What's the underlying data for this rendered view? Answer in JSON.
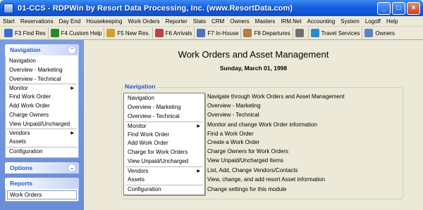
{
  "window": {
    "title": "01-CCS - RDPWin by Resort Data Processing, Inc. (www.ResortData.com)",
    "controls": [
      "_",
      "□",
      "×"
    ]
  },
  "menu": [
    "Start",
    "Reservations",
    "Day End",
    "Housekeeping",
    "Work Orders",
    "Reporter",
    "Stats",
    "CRM",
    "Owners",
    "Masters",
    "IRM.Net",
    "Accounting",
    "System",
    "Logoff",
    "Help"
  ],
  "toolbar": [
    {
      "label": "F3 Find Res",
      "icon": "find-icon",
      "color": "#3a6fd0"
    },
    {
      "label": "F4 Custom Help",
      "icon": "help-icon",
      "color": "#2a8a2a"
    },
    {
      "label": "F5 New Res.",
      "icon": "new-res-icon",
      "color": "#d0a030"
    },
    {
      "label": "F6 Arrivals",
      "icon": "arrivals-icon",
      "color": "#c04040"
    },
    {
      "label": "F7 In-House",
      "icon": "in-house-icon",
      "color": "#5070c0"
    },
    {
      "label": "F8 Departures",
      "icon": "departures-icon",
      "color": "#b08040"
    },
    {
      "label": "",
      "icon": "grid-icon",
      "color": "#707070"
    },
    {
      "label": "Travel Services",
      "icon": "globe-icon",
      "color": "#2a8ad0"
    },
    {
      "label": "Owners",
      "icon": "owners-icon",
      "color": "#6080c0"
    }
  ],
  "sidebar": {
    "navigation": {
      "title": "Navigation",
      "items": [
        {
          "label": "Navigation",
          "arrow": false
        },
        {
          "label": "Overview - Marketing",
          "arrow": false
        },
        {
          "label": "Overview - Technical",
          "arrow": false
        },
        {
          "label": "Monitor",
          "arrow": true
        },
        {
          "label": "Find Work Order",
          "arrow": false
        },
        {
          "label": "Add Work Order",
          "arrow": false
        },
        {
          "label": "Charge Owners",
          "arrow": false
        },
        {
          "label": "View Unpaid/Uncharged",
          "arrow": false
        },
        {
          "label": "Vendors",
          "arrow": true
        },
        {
          "label": "Assets",
          "arrow": false
        },
        {
          "label": "Configuration",
          "arrow": false
        }
      ]
    },
    "options": {
      "title": "Options"
    },
    "reports": {
      "title": "Reports",
      "items": [
        "Work Orders"
      ]
    }
  },
  "main": {
    "title": "Work Orders and Asset Management",
    "date": "Sunday, March 01, 1998",
    "group_label": "Navigation",
    "items": [
      {
        "label": "Navigation",
        "desc": "Navigate through Work Orders and Asset Management",
        "arrow": false
      },
      {
        "label": "Overview - Marketing",
        "desc": "Overview - Marketing",
        "arrow": false
      },
      {
        "label": "Overview - Technical",
        "desc": "Overview - Technical",
        "arrow": false
      },
      {
        "label": "Monitor",
        "desc": "Monitor and change Work Order information",
        "arrow": true
      },
      {
        "label": "Find Work Order",
        "desc": "Find a Work Order",
        "arrow": false
      },
      {
        "label": "Add Work Order",
        "desc": "Create a Work Order",
        "arrow": false
      },
      {
        "label": "Charge for Work Orders",
        "desc": "Charge Owners for Work Orders",
        "arrow": false
      },
      {
        "label": "View Unpaid/Uncharged",
        "desc": "View Unpaid/Uncharged Items",
        "arrow": false
      },
      {
        "label": "Vendors",
        "desc": "List, Add, Change Vendors/Contacts",
        "arrow": true
      },
      {
        "label": "Assets",
        "desc": "View, change, and add resort Asset information",
        "arrow": false
      },
      {
        "label": "Configuration",
        "desc": "Change settings for this module",
        "arrow": false
      }
    ]
  }
}
